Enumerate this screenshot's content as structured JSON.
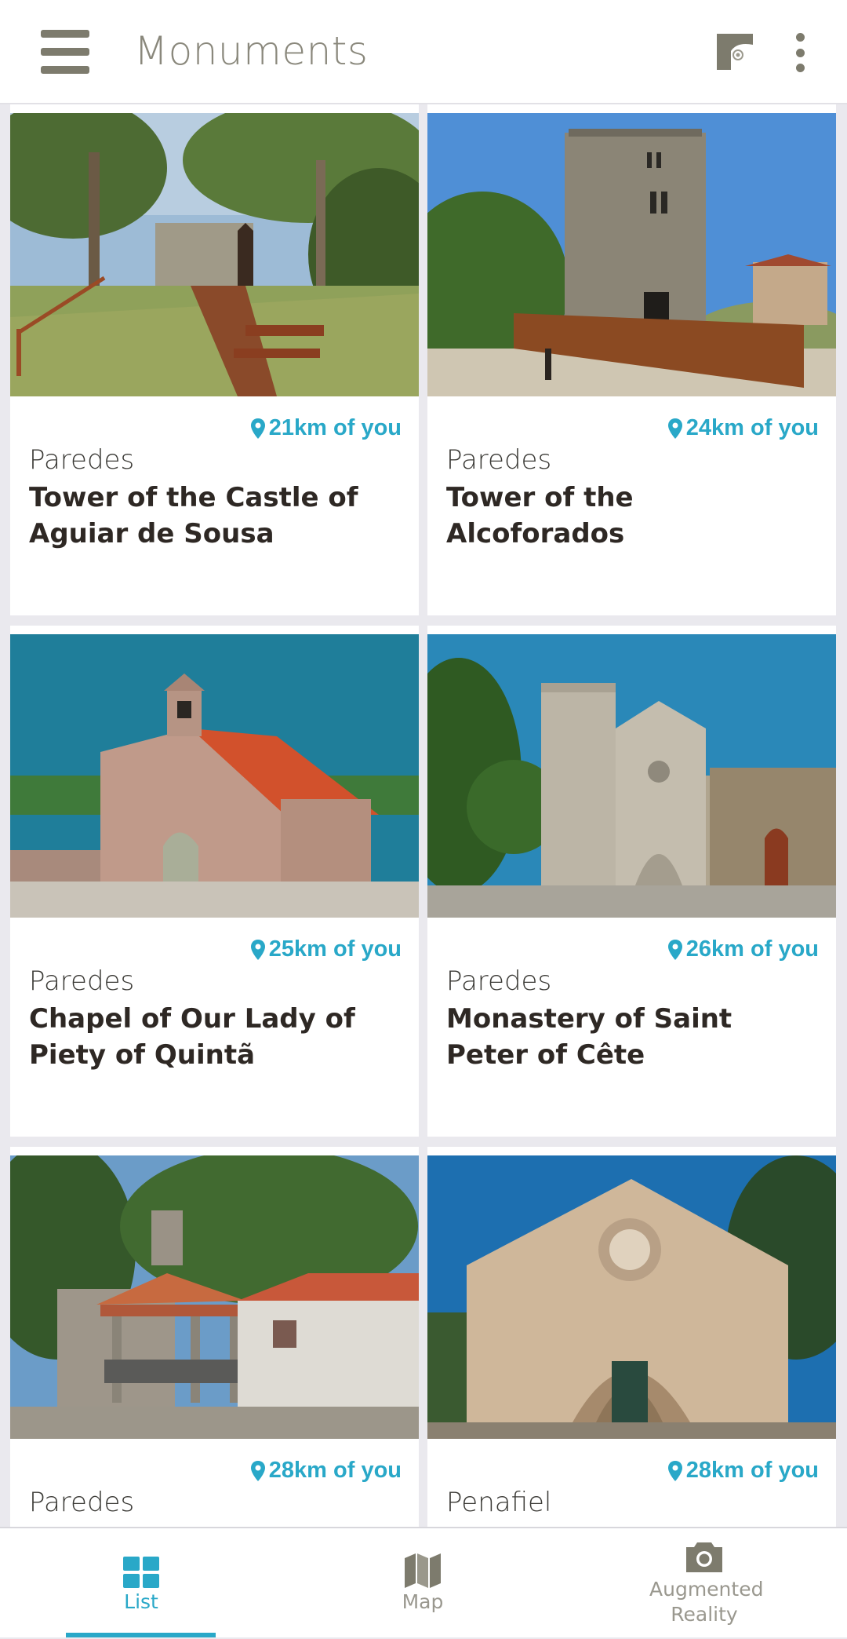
{
  "header": {
    "title": "Monuments",
    "menu_icon": "hamburger-menu-icon",
    "ar_icon": "augmented-reality-icon",
    "more_icon": "more-vertical-icon"
  },
  "cards": [
    {
      "distance": "21km of you",
      "city": "Paredes",
      "name": "Tower of the Castle of Aguiar de Sousa"
    },
    {
      "distance": "24km of you",
      "city": "Paredes",
      "name": "Tower of the Alcoforados"
    },
    {
      "distance": "25km of you",
      "city": "Paredes",
      "name": "Chapel of Our Lady of Piety of Quintã"
    },
    {
      "distance": "26km of you",
      "city": "Paredes",
      "name": "Monastery of Saint Peter of Cête"
    },
    {
      "distance": "28km of you",
      "city": "Paredes",
      "name": ""
    },
    {
      "distance": "28km of you",
      "city": "Penafiel",
      "name": ""
    }
  ],
  "bottom_nav": {
    "list": {
      "label": "List",
      "icon": "grid-icon"
    },
    "map": {
      "label": "Map",
      "icon": "map-icon"
    },
    "ar": {
      "label": "Augmented Reality",
      "icon": "camera-icon"
    }
  },
  "colors": {
    "accent": "#29a8c8",
    "icon_gray": "#7d7b6d",
    "background": "#eae9ee"
  }
}
